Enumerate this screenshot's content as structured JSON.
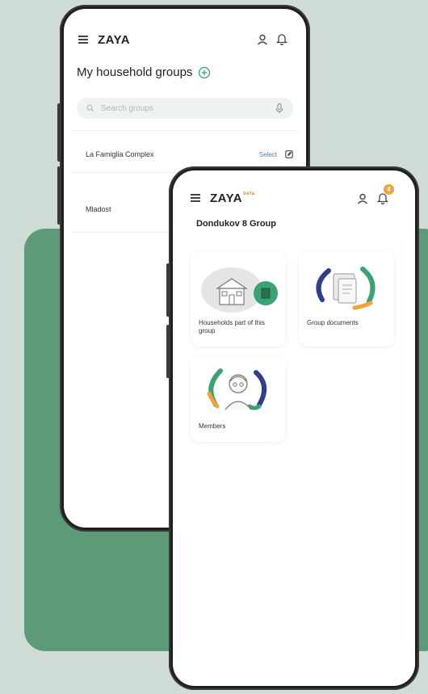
{
  "back_screen": {
    "brand": "ZAYA",
    "title": "My household groups",
    "search_placeholder": "Search groups",
    "groups": [
      {
        "name": "La Famiglia Complex",
        "action": "Select"
      },
      {
        "name": "Mladost",
        "action": ""
      }
    ]
  },
  "front_screen": {
    "brand": "ZAYA",
    "brand_tag": "beta",
    "notification_count": "4",
    "group_title": "Dondukov 8 Group",
    "cards": [
      {
        "label": "Households part of this group"
      },
      {
        "label": "Group documents"
      },
      {
        "label": "Members"
      }
    ]
  },
  "colors": {
    "background": "#cfdcd6",
    "panel_green": "#5c9a78",
    "accent_orange": "#f0a23b",
    "accent_teal": "#3aa372",
    "link_blue": "#3d7fbf"
  },
  "icons": [
    "menu-icon",
    "profile-icon",
    "bell-icon",
    "add-circle-icon",
    "search-icon",
    "mic-icon",
    "edit-icon"
  ]
}
